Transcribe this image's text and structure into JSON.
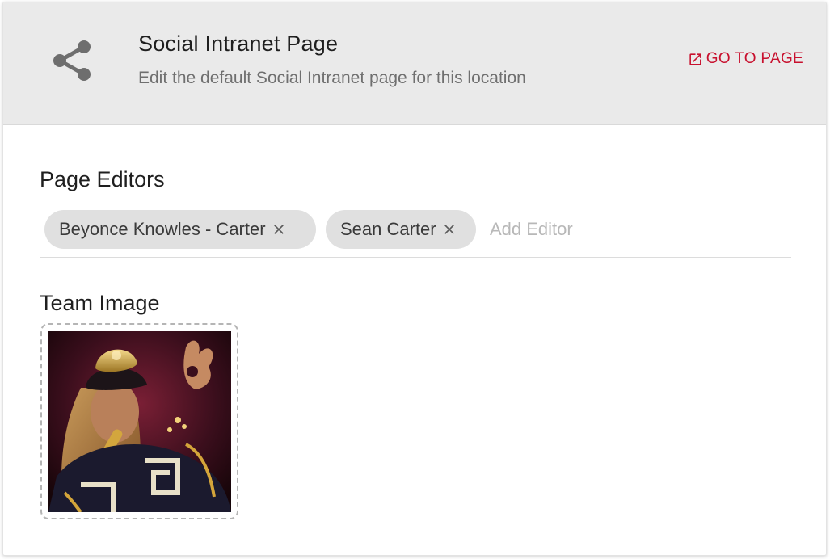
{
  "header": {
    "icon": "share-icon",
    "title": "Social Intranet Page",
    "subtitle": "Edit the default Social Intranet page for this location",
    "go_to_page_label": "GO TO PAGE",
    "go_to_page_icon": "open-in-new-icon",
    "accent_color": "#c8102e"
  },
  "editors": {
    "section_title": "Page Editors",
    "chips": [
      {
        "label": "Beyonce Knowles - Carter",
        "remove_icon": "close-icon"
      },
      {
        "label": "Sean Carter",
        "remove_icon": "close-icon"
      }
    ],
    "input_placeholder": "Add Editor",
    "input_value": ""
  },
  "team_image": {
    "section_title": "Team Image",
    "alt": "Team image"
  }
}
